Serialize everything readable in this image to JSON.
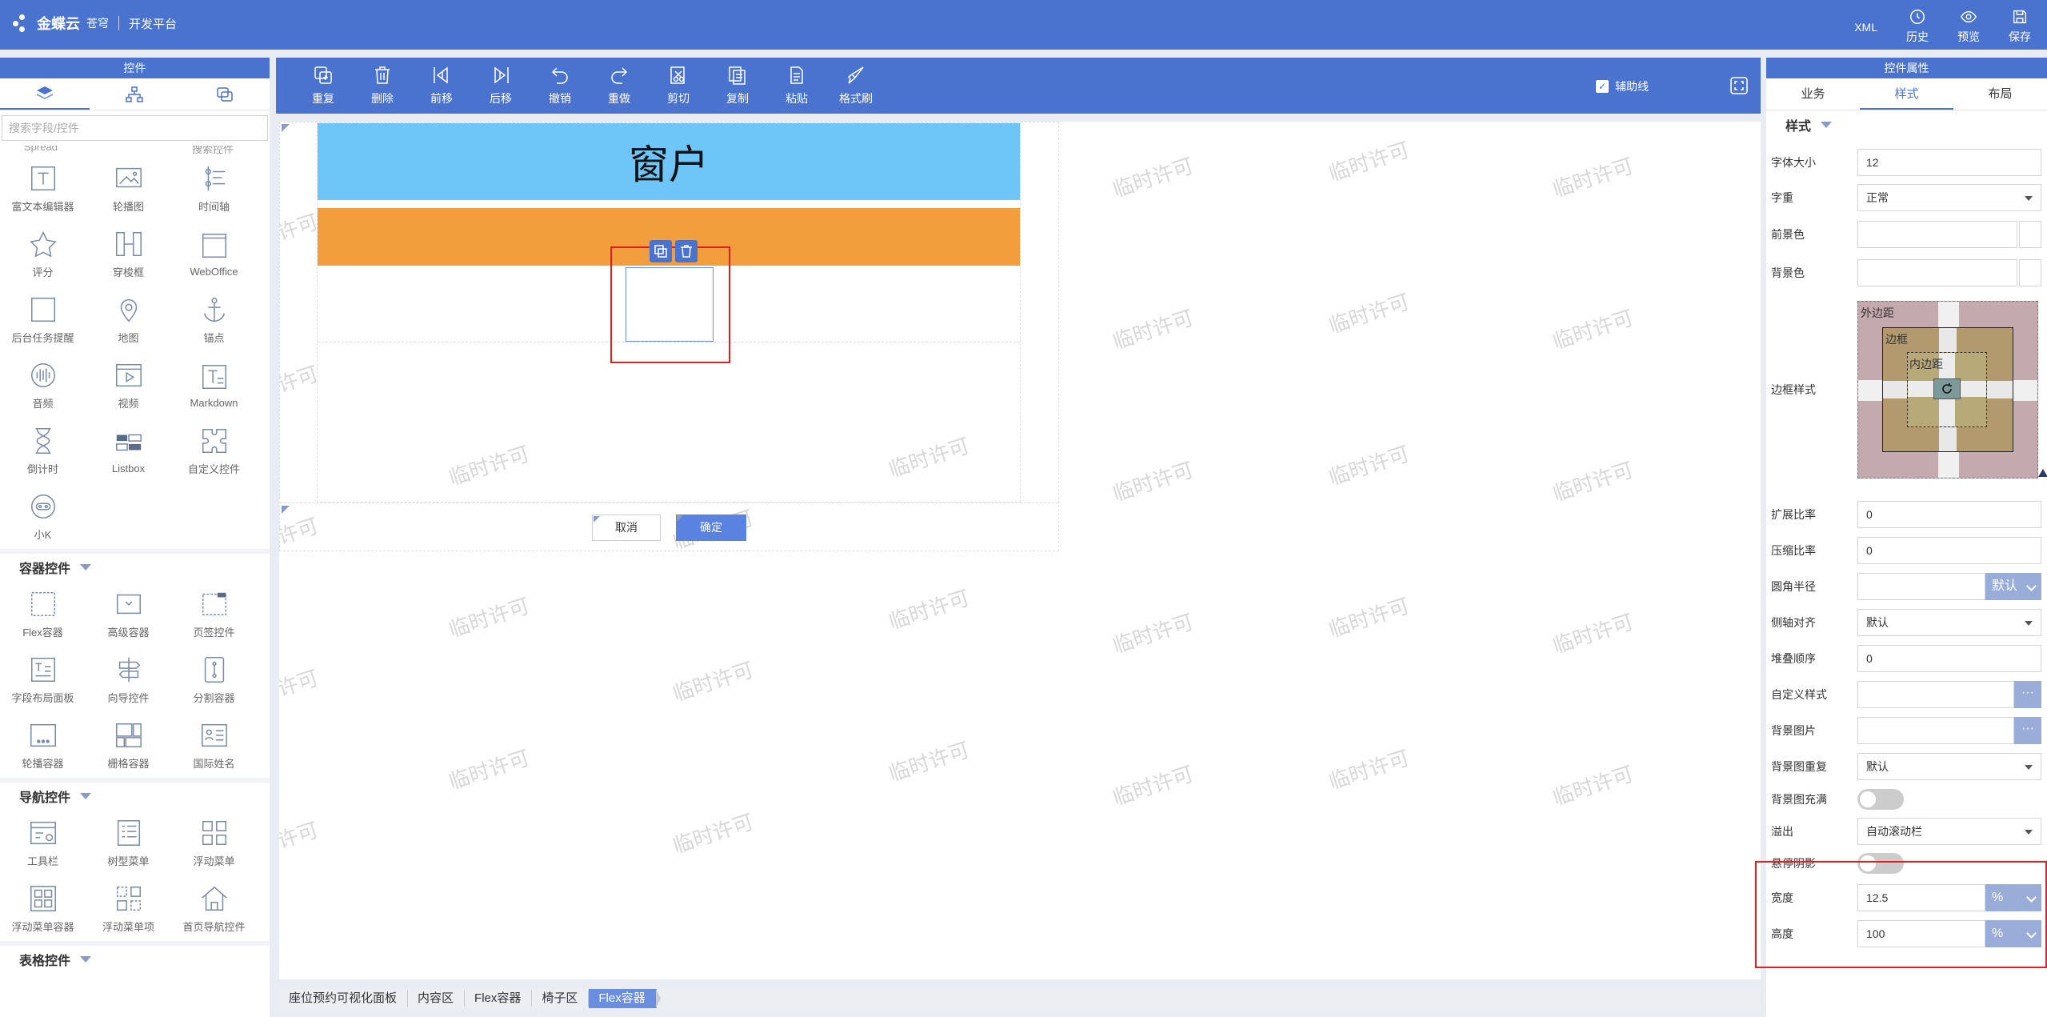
{
  "topbar": {
    "brand": "金蝶云",
    "brand_sub": "苍穹",
    "platform": "开发平台",
    "xml": "XML",
    "history": "历史",
    "preview": "预览",
    "save": "保存"
  },
  "left": {
    "title": "控件",
    "search_placeholder": "搜索字段/控件",
    "partial_labels": [
      "Spread",
      "搜索控件"
    ],
    "controls": [
      {
        "label": "富文本编辑器",
        "icon": "rich-text-icon"
      },
      {
        "label": "轮播图",
        "icon": "carousel-icon"
      },
      {
        "label": "时间轴",
        "icon": "timeline-icon"
      },
      {
        "label": "评分",
        "icon": "rating-icon"
      },
      {
        "label": "穿梭框",
        "icon": "transfer-icon"
      },
      {
        "label": "WebOffice",
        "icon": "weboffice-icon"
      },
      {
        "label": "后台任务提醒",
        "icon": "task-icon"
      },
      {
        "label": "地图",
        "icon": "map-icon"
      },
      {
        "label": "锚点",
        "icon": "anchor-icon"
      },
      {
        "label": "音频",
        "icon": "audio-icon"
      },
      {
        "label": "视频",
        "icon": "video-icon"
      },
      {
        "label": "Markdown",
        "icon": "markdown-icon"
      },
      {
        "label": "倒计时",
        "icon": "hourglass-icon"
      },
      {
        "label": "Listbox",
        "icon": "listbox-icon"
      },
      {
        "label": "自定义控件",
        "icon": "puzzle-icon"
      },
      {
        "label": "小K",
        "icon": "robot-icon"
      }
    ],
    "sections": [
      {
        "title": "容器控件",
        "items": [
          {
            "label": "Flex容器",
            "icon": "flex-icon"
          },
          {
            "label": "高级容器",
            "icon": "advanced-container-icon"
          },
          {
            "label": "页签控件",
            "icon": "tab-control-icon"
          },
          {
            "label": "字段布局面板",
            "icon": "field-layout-icon"
          },
          {
            "label": "向导控件",
            "icon": "wizard-icon"
          },
          {
            "label": "分割容器",
            "icon": "split-icon"
          },
          {
            "label": "轮播容器",
            "icon": "carousel-container-icon"
          },
          {
            "label": "栅格容器",
            "icon": "grid-icon"
          },
          {
            "label": "国际姓名",
            "icon": "name-card-icon"
          }
        ]
      },
      {
        "title": "导航控件",
        "items": [
          {
            "label": "工具栏",
            "icon": "toolbar-icon"
          },
          {
            "label": "树型菜单",
            "icon": "tree-menu-icon"
          },
          {
            "label": "浮动菜单",
            "icon": "float-menu-icon"
          },
          {
            "label": "浮动菜单容器",
            "icon": "float-menu-container-icon"
          },
          {
            "label": "浮动菜单项",
            "icon": "float-menu-item-icon"
          },
          {
            "label": "首页导航控件",
            "icon": "home-icon"
          }
        ]
      },
      {
        "title": "表格控件",
        "items": []
      }
    ]
  },
  "toolbar": {
    "items": [
      {
        "label": "重复",
        "icon": "duplicate-icon"
      },
      {
        "label": "删除",
        "icon": "trash-icon"
      },
      {
        "label": "前移",
        "icon": "move-forward-icon"
      },
      {
        "label": "后移",
        "icon": "move-back-icon"
      },
      {
        "label": "撤销",
        "icon": "undo-icon"
      },
      {
        "label": "重做",
        "icon": "redo-icon"
      },
      {
        "label": "剪切",
        "icon": "cut-icon"
      },
      {
        "label": "复制",
        "icon": "copy-icon"
      },
      {
        "label": "粘贴",
        "icon": "paste-icon"
      },
      {
        "label": "格式刷",
        "icon": "format-brush-icon"
      }
    ],
    "aux_label": "辅助线",
    "aux_checked": true
  },
  "canvas": {
    "title": "窗户",
    "cancel": "取消",
    "confirm": "确定",
    "watermark": "临时许可"
  },
  "breadcrumb": [
    "座位预约可视化面板",
    "内容区",
    "Flex容器",
    "椅子区",
    "Flex容器"
  ],
  "right": {
    "title": "控件属性",
    "tabs": [
      "业务",
      "样式",
      "布局"
    ],
    "active_tab": 1,
    "section": "样式",
    "props": {
      "font_size": {
        "label": "字体大小",
        "value": "12"
      },
      "font_weight": {
        "label": "字重",
        "value": "正常"
      },
      "fg_color": {
        "label": "前景色",
        "value": ""
      },
      "bg_color": {
        "label": "背景色",
        "value": ""
      },
      "border_style": {
        "label": "边框样式"
      },
      "box_model": {
        "margin": "外边距",
        "border": "边框",
        "padding": "内边距"
      },
      "grow": {
        "label": "扩展比率",
        "value": "0"
      },
      "shrink": {
        "label": "压缩比率",
        "value": "0"
      },
      "radius": {
        "label": "圆角半径",
        "value": "",
        "unit": "默认"
      },
      "align_self": {
        "label": "侧轴对齐",
        "value": "默认"
      },
      "z_index": {
        "label": "堆叠顺序",
        "value": "0"
      },
      "custom_style": {
        "label": "自定义样式",
        "value": "",
        "button": "···"
      },
      "bg_image": {
        "label": "背景图片",
        "value": "",
        "button": "···"
      },
      "bg_repeat": {
        "label": "背景图重复",
        "value": "默认"
      },
      "bg_fill": {
        "label": "背景图充满",
        "on": false
      },
      "overflow": {
        "label": "溢出",
        "value": "自动滚动栏"
      },
      "hover_shadow": {
        "label": "悬停阴影",
        "on": false
      },
      "width": {
        "label": "宽度",
        "value": "12.5",
        "unit": "%"
      },
      "height": {
        "label": "高度",
        "value": "100",
        "unit": "%"
      }
    }
  },
  "colors": {
    "primary": "#4a72cf",
    "title_bar": "#6ec6f8",
    "orange_bar": "#f29e3d",
    "highlight": "#e02020"
  }
}
